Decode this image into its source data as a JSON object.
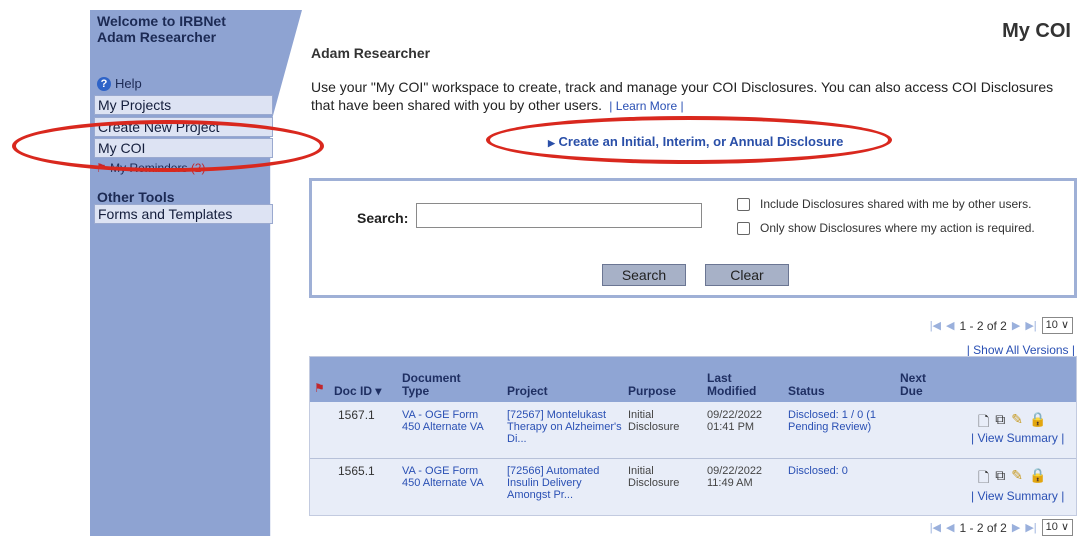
{
  "sidebar": {
    "welcome": "Welcome to IRBNet",
    "user": "Adam Researcher",
    "help_label": "Help",
    "items": [
      {
        "label": "My Projects"
      },
      {
        "label": "Create New Project"
      },
      {
        "label": "My COI"
      }
    ],
    "reminders_label": "My Reminders",
    "reminders_count": "(2)",
    "other_tools_heading": "Other Tools",
    "other_items": [
      {
        "label": "Forms and Templates"
      }
    ]
  },
  "header": {
    "page_title": "My COI",
    "user_name": "Adam Researcher",
    "intro": "Use your \"My COI\" workspace to create, track and manage your COI Disclosures. You can also access COI Disclosures that have been shared with you by other users.",
    "learn_more": "Learn More",
    "create_link": "Create an Initial, Interim, or Annual Disclosure"
  },
  "search": {
    "label": "Search:",
    "value": "",
    "opt_shared": "Include Disclosures shared with me by other users.",
    "opt_action": "Only show Disclosures where my action is required.",
    "search_btn": "Search",
    "clear_btn": "Clear"
  },
  "pager": {
    "range": "1 - 2 of 2",
    "page_size": "10 ∨"
  },
  "show_all_versions": "Show All Versions",
  "table": {
    "headers": {
      "doc_id": "Doc ID ▾",
      "doc_type": "Document Type",
      "project": "Project",
      "purpose": "Purpose",
      "last_modified": "Last Modified",
      "status": "Status",
      "next_due": "Next Due"
    },
    "rows": [
      {
        "doc_id": "1567.1",
        "doc_type": "VA - OGE Form 450 Alternate VA",
        "project": "[72567] Montelukast Therapy on Alzheimer's Di...",
        "purpose": "Initial Disclosure",
        "last_modified": "09/22/2022 01:41 PM",
        "status": "Disclosed: 1 / 0 (1 Pending Review)",
        "view_summary": "View Summary"
      },
      {
        "doc_id": "1565.1",
        "doc_type": "VA - OGE Form 450 Alternate VA",
        "project": "[72566] Automated Insulin Delivery Amongst Pr...",
        "purpose": "Initial Disclosure",
        "last_modified": "09/22/2022 11:49 AM",
        "status": "Disclosed: 0",
        "view_summary": "View Summary"
      }
    ]
  },
  "colors": {
    "sidebar": "#8ea3d2",
    "accent_link": "#2a50b4",
    "annotation_red": "#d9281e"
  },
  "icons": [
    "help-icon",
    "flag-icon",
    "document-icon",
    "copy-icon",
    "pencil-icon",
    "lock-icon",
    "first-page-icon",
    "prev-page-icon",
    "next-page-icon",
    "last-page-icon"
  ]
}
